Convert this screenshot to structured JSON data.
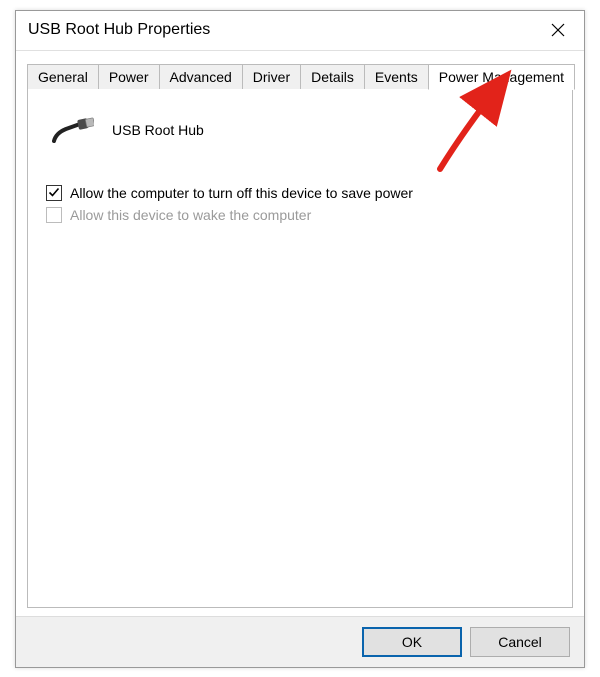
{
  "window": {
    "title": "USB Root Hub Properties"
  },
  "tabs": [
    {
      "label": "General"
    },
    {
      "label": "Power"
    },
    {
      "label": "Advanced"
    },
    {
      "label": "Driver"
    },
    {
      "label": "Details"
    },
    {
      "label": "Events"
    },
    {
      "label": "Power Management",
      "active": true
    }
  ],
  "device": {
    "name": "USB Root Hub"
  },
  "options": {
    "allowTurnOff": {
      "label": "Allow the computer to turn off this device to save power",
      "checked": true,
      "enabled": true
    },
    "allowWake": {
      "label": "Allow this device to wake the computer",
      "checked": false,
      "enabled": false
    }
  },
  "buttons": {
    "ok": "OK",
    "cancel": "Cancel"
  }
}
